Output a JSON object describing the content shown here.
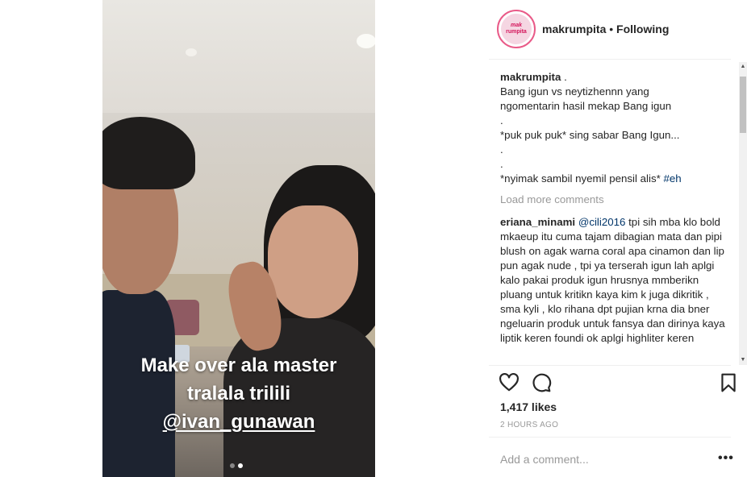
{
  "media": {
    "overlay_lines": [
      "Make over ala master",
      "tralala trilili"
    ],
    "overlay_handle": "@ivan_gunawan",
    "carousel": {
      "count": 2,
      "active_index": 1
    }
  },
  "header": {
    "avatar_text_top": "mak",
    "avatar_text_bottom": "rumpita",
    "username": "makrumpita",
    "separator": " • ",
    "follow_status": "Following"
  },
  "caption": {
    "user": "makrumpita",
    "first_line_suffix": " .",
    "lines": [
      "Bang igun vs neytizhennn yang",
      "ngomentarin hasil mekap Bang igun",
      ".",
      "*puk puk puk* sing sabar Bang Igun...",
      ".",
      ".",
      "*nyimak sambil nyemil pensil alis* "
    ],
    "hashtag": "#eh"
  },
  "load_more_label": "Load more comments",
  "comment": {
    "user": "eriana_minami",
    "mention": "@cili2016",
    "text": " tpi sih mba klo bold mkaeup itu cuma tajam dibagian mata dan pipi blush on agak warna coral apa cinamon dan lip pun agak nude , tpi ya terserah igun lah aplgi kalo pakai produk igun hrusnya mmberikn pluang untuk kritikn kaya kim k juga dikritik , sma kyli , klo rihana dpt pujian krna dia bner ngeluarin produk untuk fansya dan dirinya kaya liptik keren foundi ok aplgi highliter keren"
  },
  "likes_text": "1,417 likes",
  "timestamp": "2 HOURS AGO",
  "add_comment_placeholder": "Add a comment...",
  "more_label": "•••",
  "icons": {
    "like": "heart-icon",
    "comment": "comment-bubble-icon",
    "save": "bookmark-icon"
  },
  "colors": {
    "link": "#003569",
    "muted": "#999999",
    "text": "#262626",
    "avatar_ring": "#e95a88"
  }
}
